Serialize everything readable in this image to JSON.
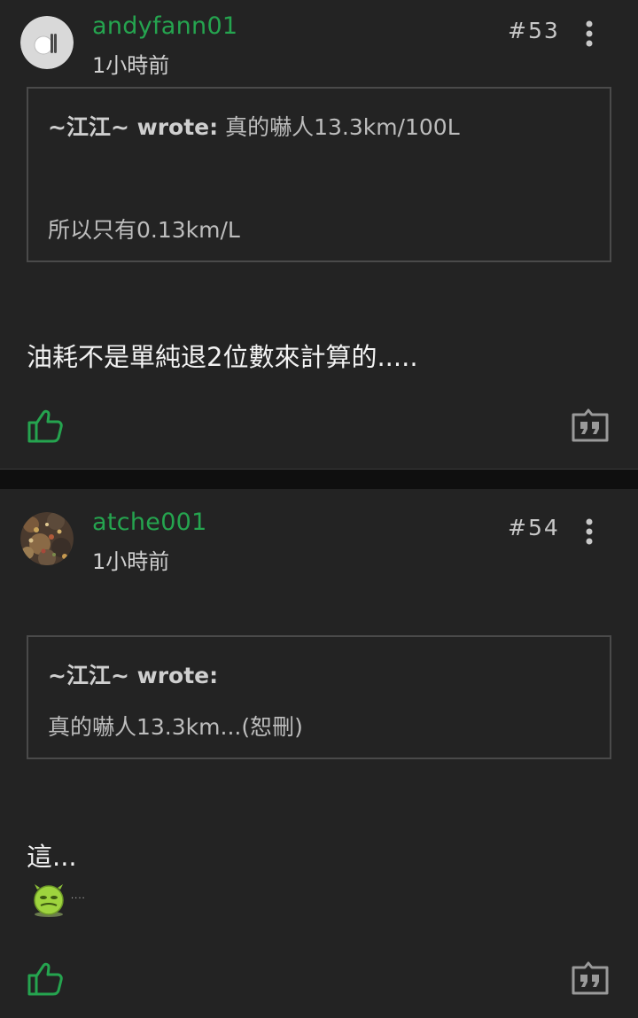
{
  "posts": [
    {
      "username": "andyfann01",
      "time": "1小時前",
      "floor": "#53",
      "quote": {
        "author": "~江江~ wrote:",
        "line1": "真的嚇人13.3km/100L",
        "line2": "所以只有0.13km/L"
      },
      "body": "油耗不是單純退2位數來計算的....."
    },
    {
      "username": "atche001",
      "time": "1小時前",
      "floor": "#54",
      "quote": {
        "author": "~江江~ wrote:",
        "line1": "真的嚇人13.3km...(恕刪)"
      },
      "body": "這...",
      "emoji_trail": "····"
    }
  ],
  "colors": {
    "background": "#232323",
    "username": "#25a44f",
    "like_icon": "#25a44f",
    "divider": "#0f0f0f"
  },
  "icons": [
    "more-vertical-icon",
    "thumbs-up-icon",
    "quote-icon",
    "avatar-icon",
    "emoji-icon"
  ]
}
